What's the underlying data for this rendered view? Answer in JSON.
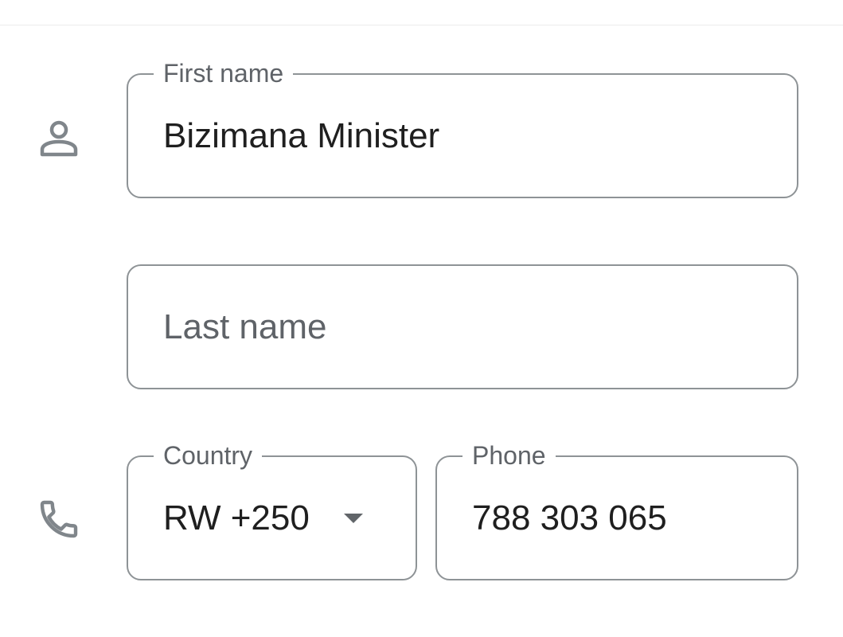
{
  "name_section": {
    "icon": "person-icon",
    "first_name": {
      "label": "First name",
      "value": "Bizimana Minister"
    },
    "last_name": {
      "placeholder": "Last name",
      "value": ""
    }
  },
  "phone_section": {
    "icon": "phone-icon",
    "country": {
      "label": "Country",
      "value": "RW +250"
    },
    "phone": {
      "label": "Phone",
      "value": "788 303 065"
    }
  },
  "colors": {
    "border": "#8e9396",
    "label": "#5f6368",
    "icon": "#80868b",
    "text": "#1f1f1f"
  }
}
